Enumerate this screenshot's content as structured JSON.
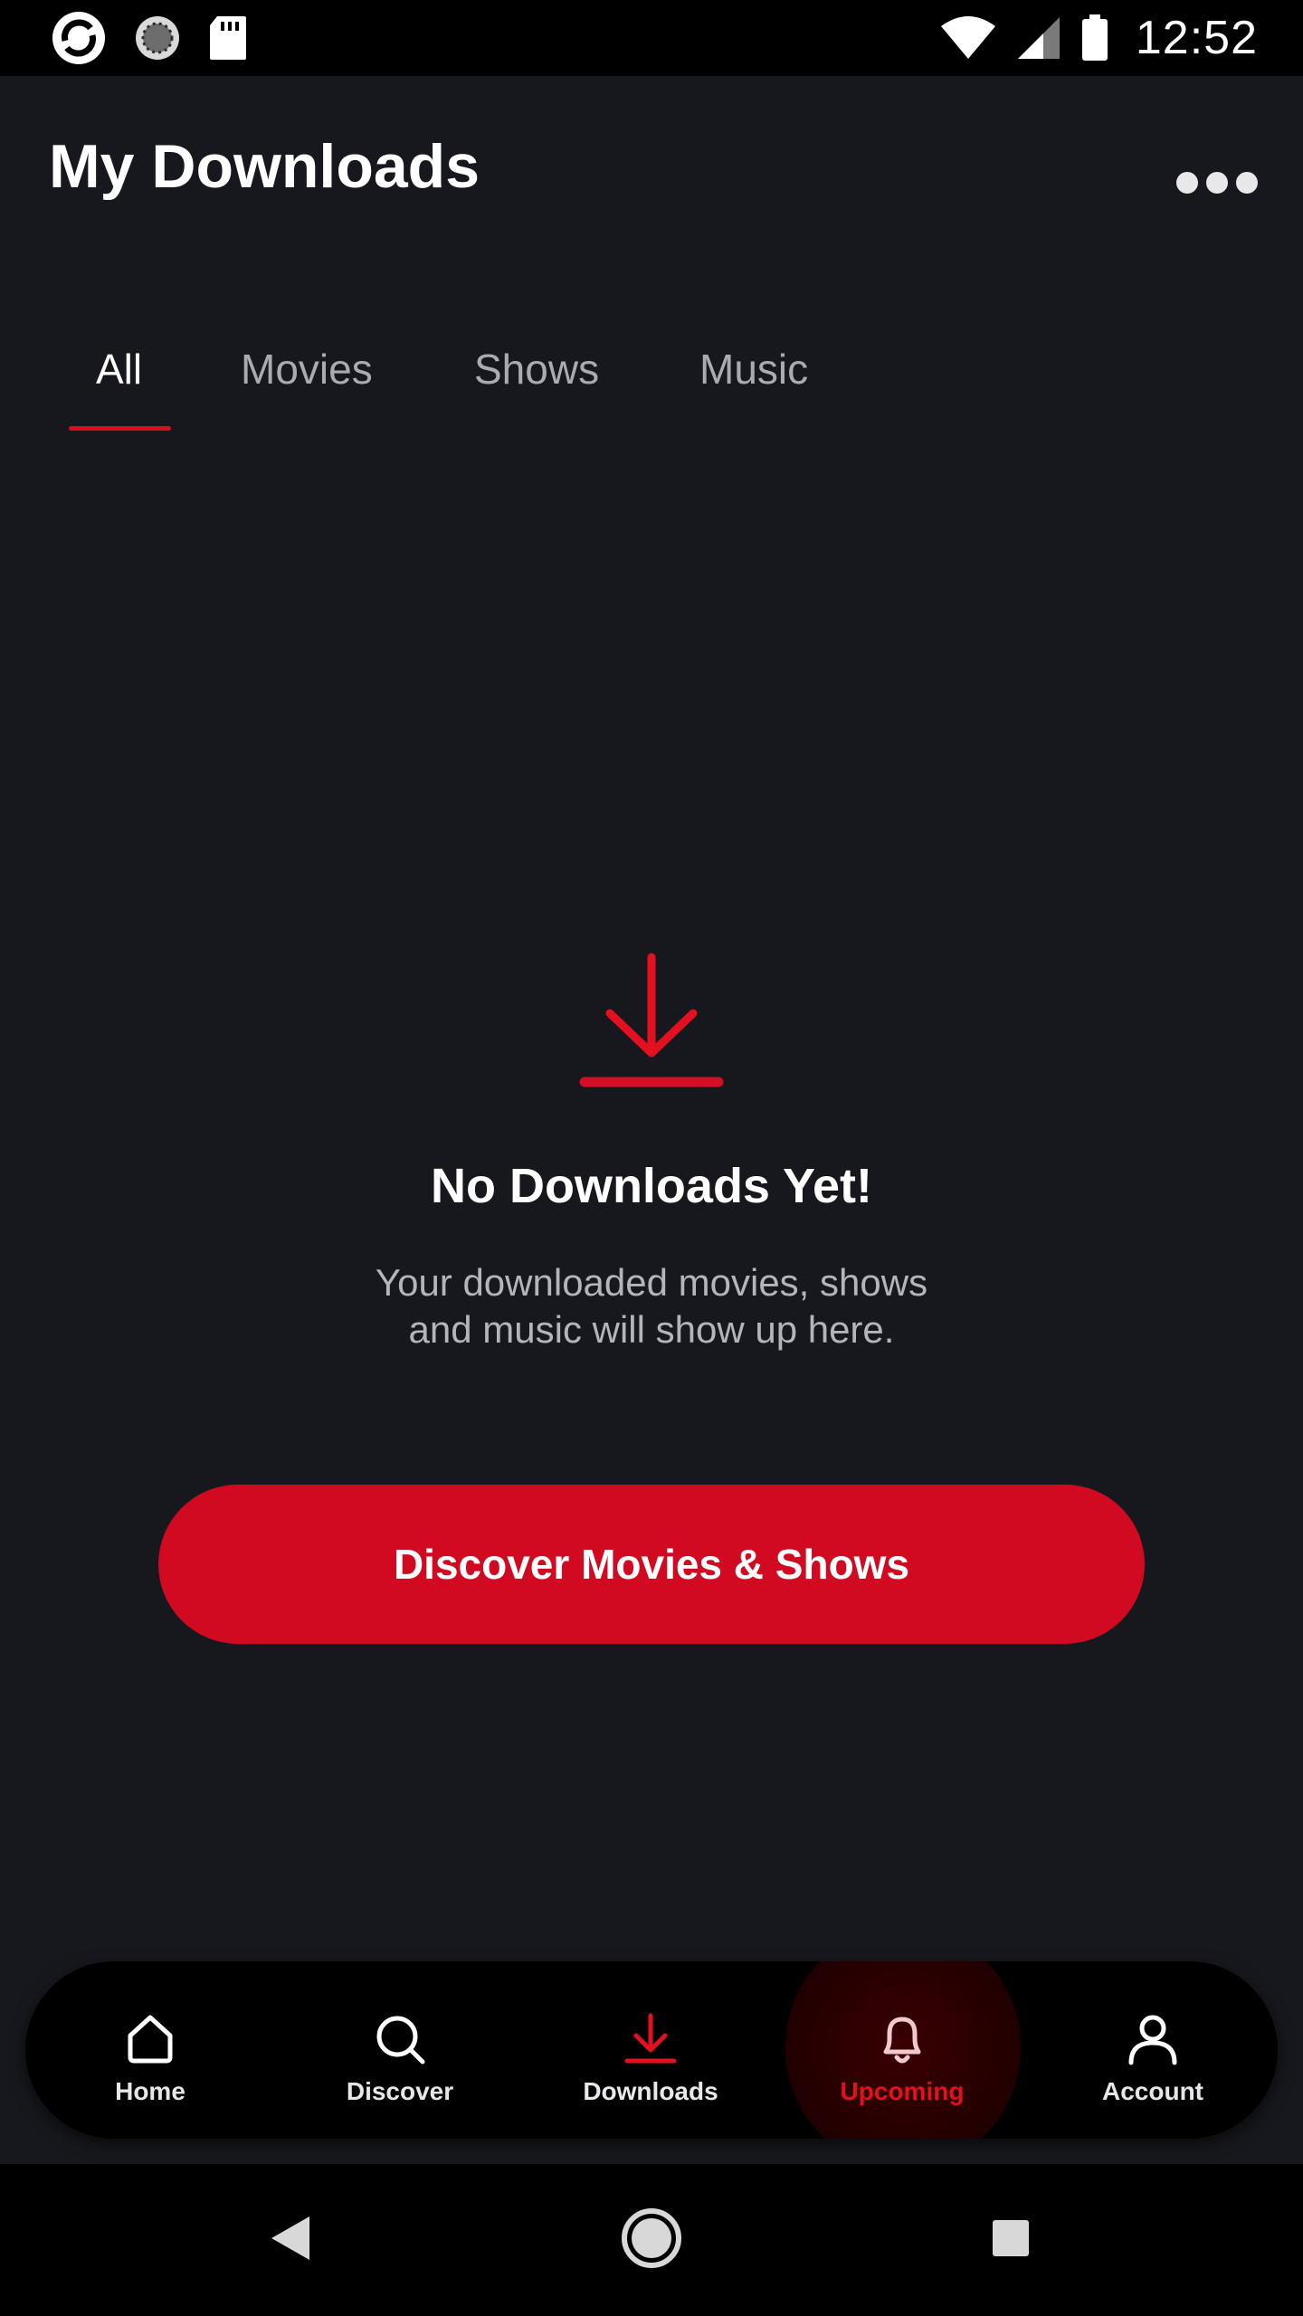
{
  "status_bar": {
    "time": "12:52",
    "left_icons": [
      "sync-app-icon",
      "loading-circle-icon",
      "sd-card-icon"
    ],
    "right_icons": [
      "wifi-icon",
      "signal-icon",
      "battery-icon"
    ]
  },
  "header": {
    "title": "My Downloads",
    "more_icon": "more-horizontal-icon"
  },
  "tabs": [
    {
      "label": "All",
      "active": true
    },
    {
      "label": "Movies",
      "active": false
    },
    {
      "label": "Shows",
      "active": false
    },
    {
      "label": "Music",
      "active": false
    }
  ],
  "empty_state": {
    "icon": "download-icon",
    "title": "No Downloads Yet!",
    "description_line1": "Your downloaded movies, shows",
    "description_line2": "and music will show up here."
  },
  "cta": {
    "label": "Discover Movies & Shows"
  },
  "bottom_nav": {
    "items": [
      {
        "label": "Home",
        "icon": "home-icon"
      },
      {
        "label": "Discover",
        "icon": "search-icon"
      },
      {
        "label": "Downloads",
        "icon": "download-icon"
      },
      {
        "label": "Upcoming",
        "icon": "bell-icon"
      },
      {
        "label": "Account",
        "icon": "user-icon"
      }
    ]
  },
  "system_nav": [
    "back-icon",
    "home-circle-icon",
    "recents-icon"
  ],
  "colors": {
    "background": "#17181d",
    "accent": "#d10a22",
    "tab_inactive": "#a9abb2",
    "text_secondary": "#b3b5bb",
    "upcoming_label": "#e3101f"
  }
}
